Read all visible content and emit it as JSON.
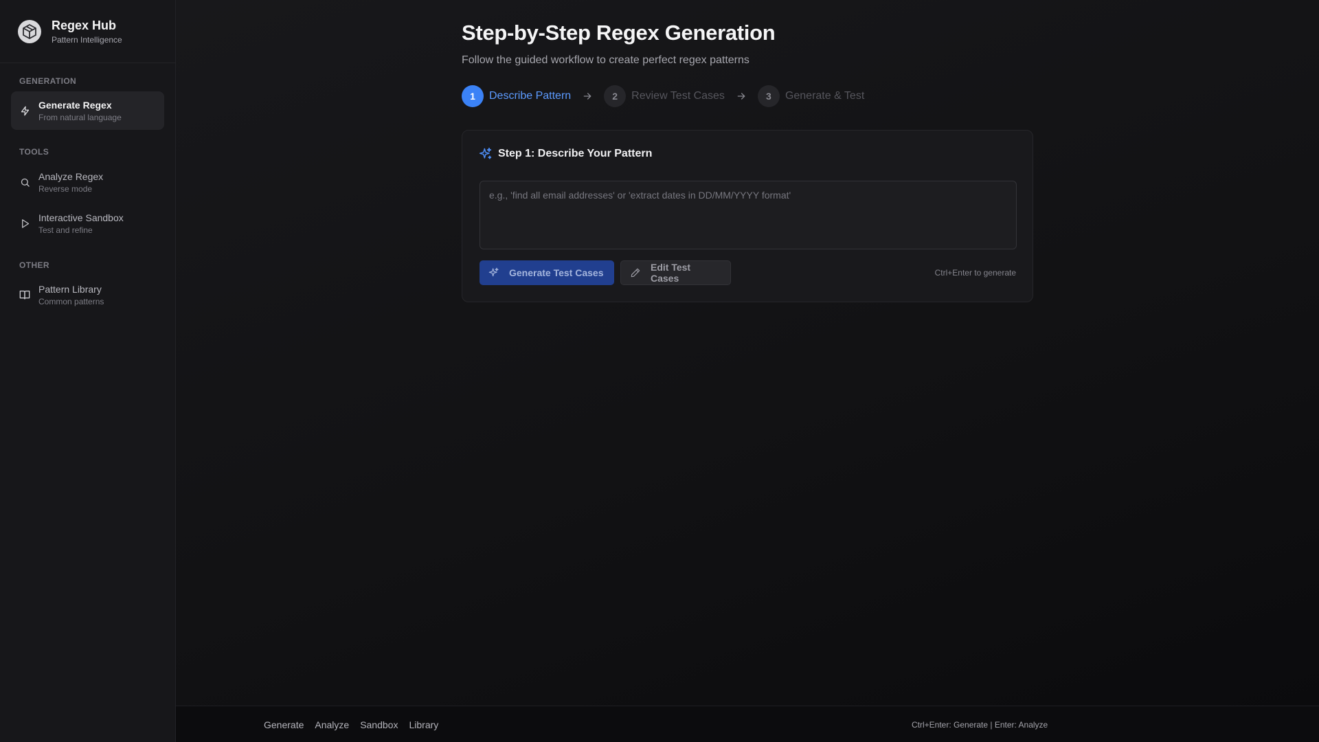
{
  "brand": {
    "title": "Regex Hub",
    "subtitle": "Pattern Intelligence",
    "logo_icon": "cube-logo-icon"
  },
  "sidebar": {
    "sections": [
      {
        "title": "GENERATION",
        "items": [
          {
            "label": "Generate Regex",
            "description": "From natural language",
            "icon": "lightning-icon",
            "active": true
          }
        ]
      },
      {
        "title": "TOOLS",
        "items": [
          {
            "label": "Analyze Regex",
            "description": "Reverse mode",
            "icon": "search-icon",
            "active": false
          },
          {
            "label": "Interactive Sandbox",
            "description": "Test and refine",
            "icon": "play-icon",
            "active": false
          }
        ]
      },
      {
        "title": "OTHER",
        "items": [
          {
            "label": "Pattern Library",
            "description": "Common patterns",
            "icon": "book-open-icon",
            "active": false
          }
        ]
      }
    ]
  },
  "main": {
    "title": "Step-by-Step Regex Generation",
    "subtitle": "Follow the guided workflow to create perfect regex patterns",
    "steps": [
      {
        "number": "1",
        "label": "Describe Pattern",
        "state": "active"
      },
      {
        "number": "2",
        "label": "Review Test Cases",
        "state": "inactive"
      },
      {
        "number": "3",
        "label": "Generate & Test",
        "state": "inactive"
      }
    ],
    "card": {
      "title": "Step 1: Describe Your Pattern",
      "title_icon": "sparkles-icon",
      "input_value": "",
      "input_placeholder": "e.g., 'find all email addresses' or 'extract dates in DD/MM/YYYY format'",
      "generate_button_label": "Generate Test Cases",
      "generate_button_icon": "sparkles-icon",
      "edit_button_label": "Edit Test Cases",
      "edit_button_icon": "pencil-icon",
      "shortcut_hint": "Ctrl+Enter to generate"
    }
  },
  "footer": {
    "links": [
      "Generate",
      "Analyze",
      "Sandbox",
      "Library"
    ],
    "shortcuts": "Ctrl+Enter: Generate | Enter: Analyze"
  },
  "colors": {
    "accent": "#3b82f6",
    "primary_button": "#213f8f",
    "sidebar_bg": "#17171a",
    "main_bg": "#121214"
  }
}
